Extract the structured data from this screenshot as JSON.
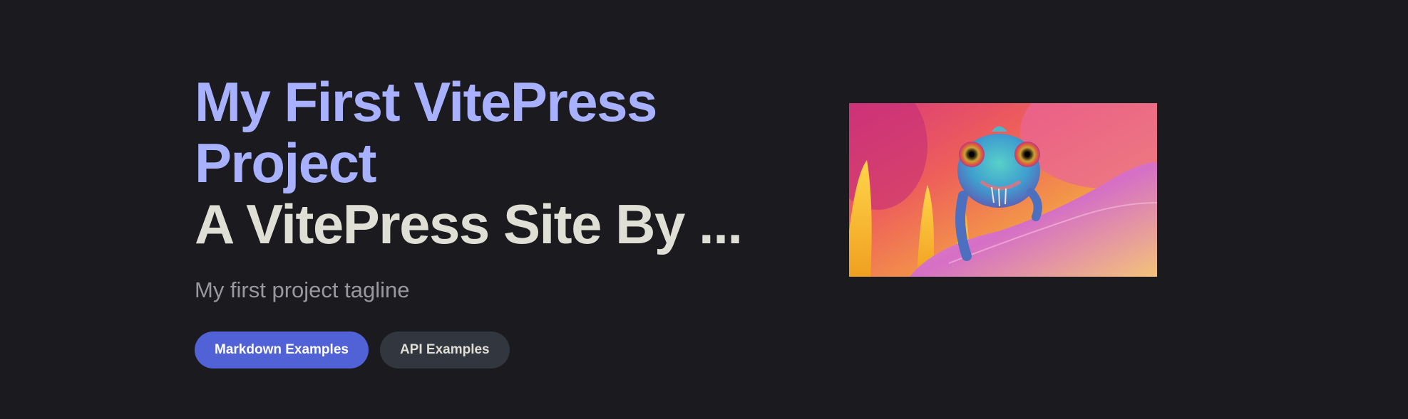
{
  "hero": {
    "name": "My First VitePress Project",
    "title": "A VitePress Site By ...",
    "tagline": "My first project tagline",
    "image": {
      "subject": "colorful chameleon on a flower",
      "colors": [
        "#e44a8a",
        "#f7b23b",
        "#3bb6c4",
        "#c06ad3"
      ]
    },
    "actions": [
      {
        "label": "Markdown Examples",
        "theme": "brand"
      },
      {
        "label": "API Examples",
        "theme": "alt"
      }
    ]
  },
  "colors": {
    "background": "#1b1b1f",
    "name": "#a8b1ff",
    "title": "#dfdfd6",
    "tagline": "#98989f",
    "brand_button": "#5161d6",
    "alt_button": "#32363f"
  }
}
